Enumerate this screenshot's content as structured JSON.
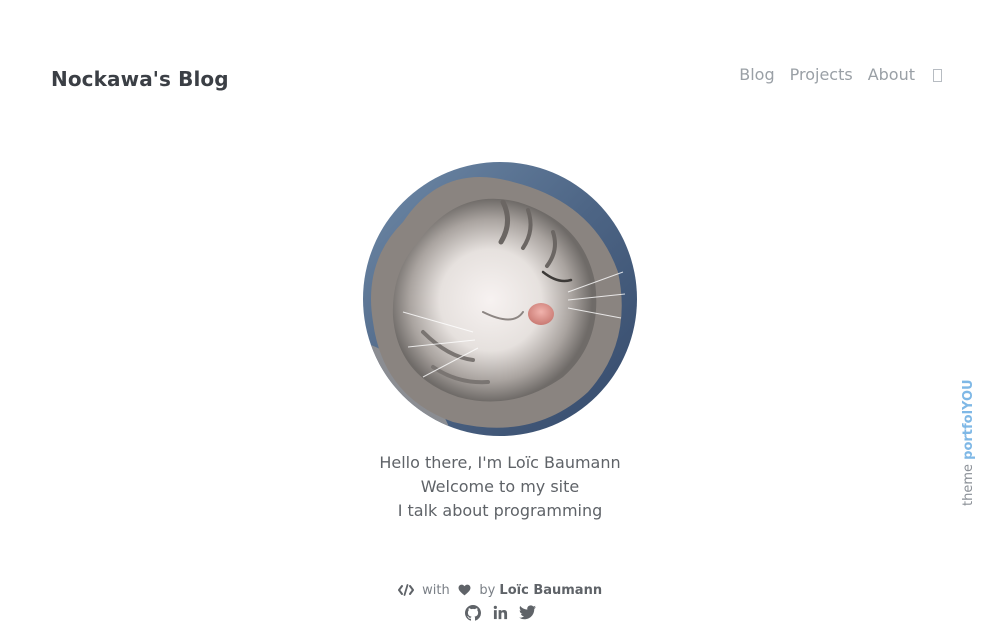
{
  "header": {
    "site_title": "Nockawa's Blog",
    "nav": [
      {
        "label": "Blog"
      },
      {
        "label": "Projects"
      },
      {
        "label": "About"
      }
    ]
  },
  "intro": {
    "lines": [
      "Hello there, I'm Loïc Baumann",
      "Welcome to my site",
      "I talk about programming"
    ]
  },
  "footer": {
    "with_text": "with",
    "by_text": "by",
    "author": "Loïc Baumann",
    "socials": [
      "github-icon",
      "linkedin-icon",
      "twitter-icon"
    ]
  },
  "credit": {
    "prefix": "theme",
    "brand": "portfolYOU"
  },
  "colors": {
    "title": "#3b3f45",
    "nav": "#9aa0a6",
    "text": "#5f6368",
    "brand_accent": "#7fb8e6"
  }
}
